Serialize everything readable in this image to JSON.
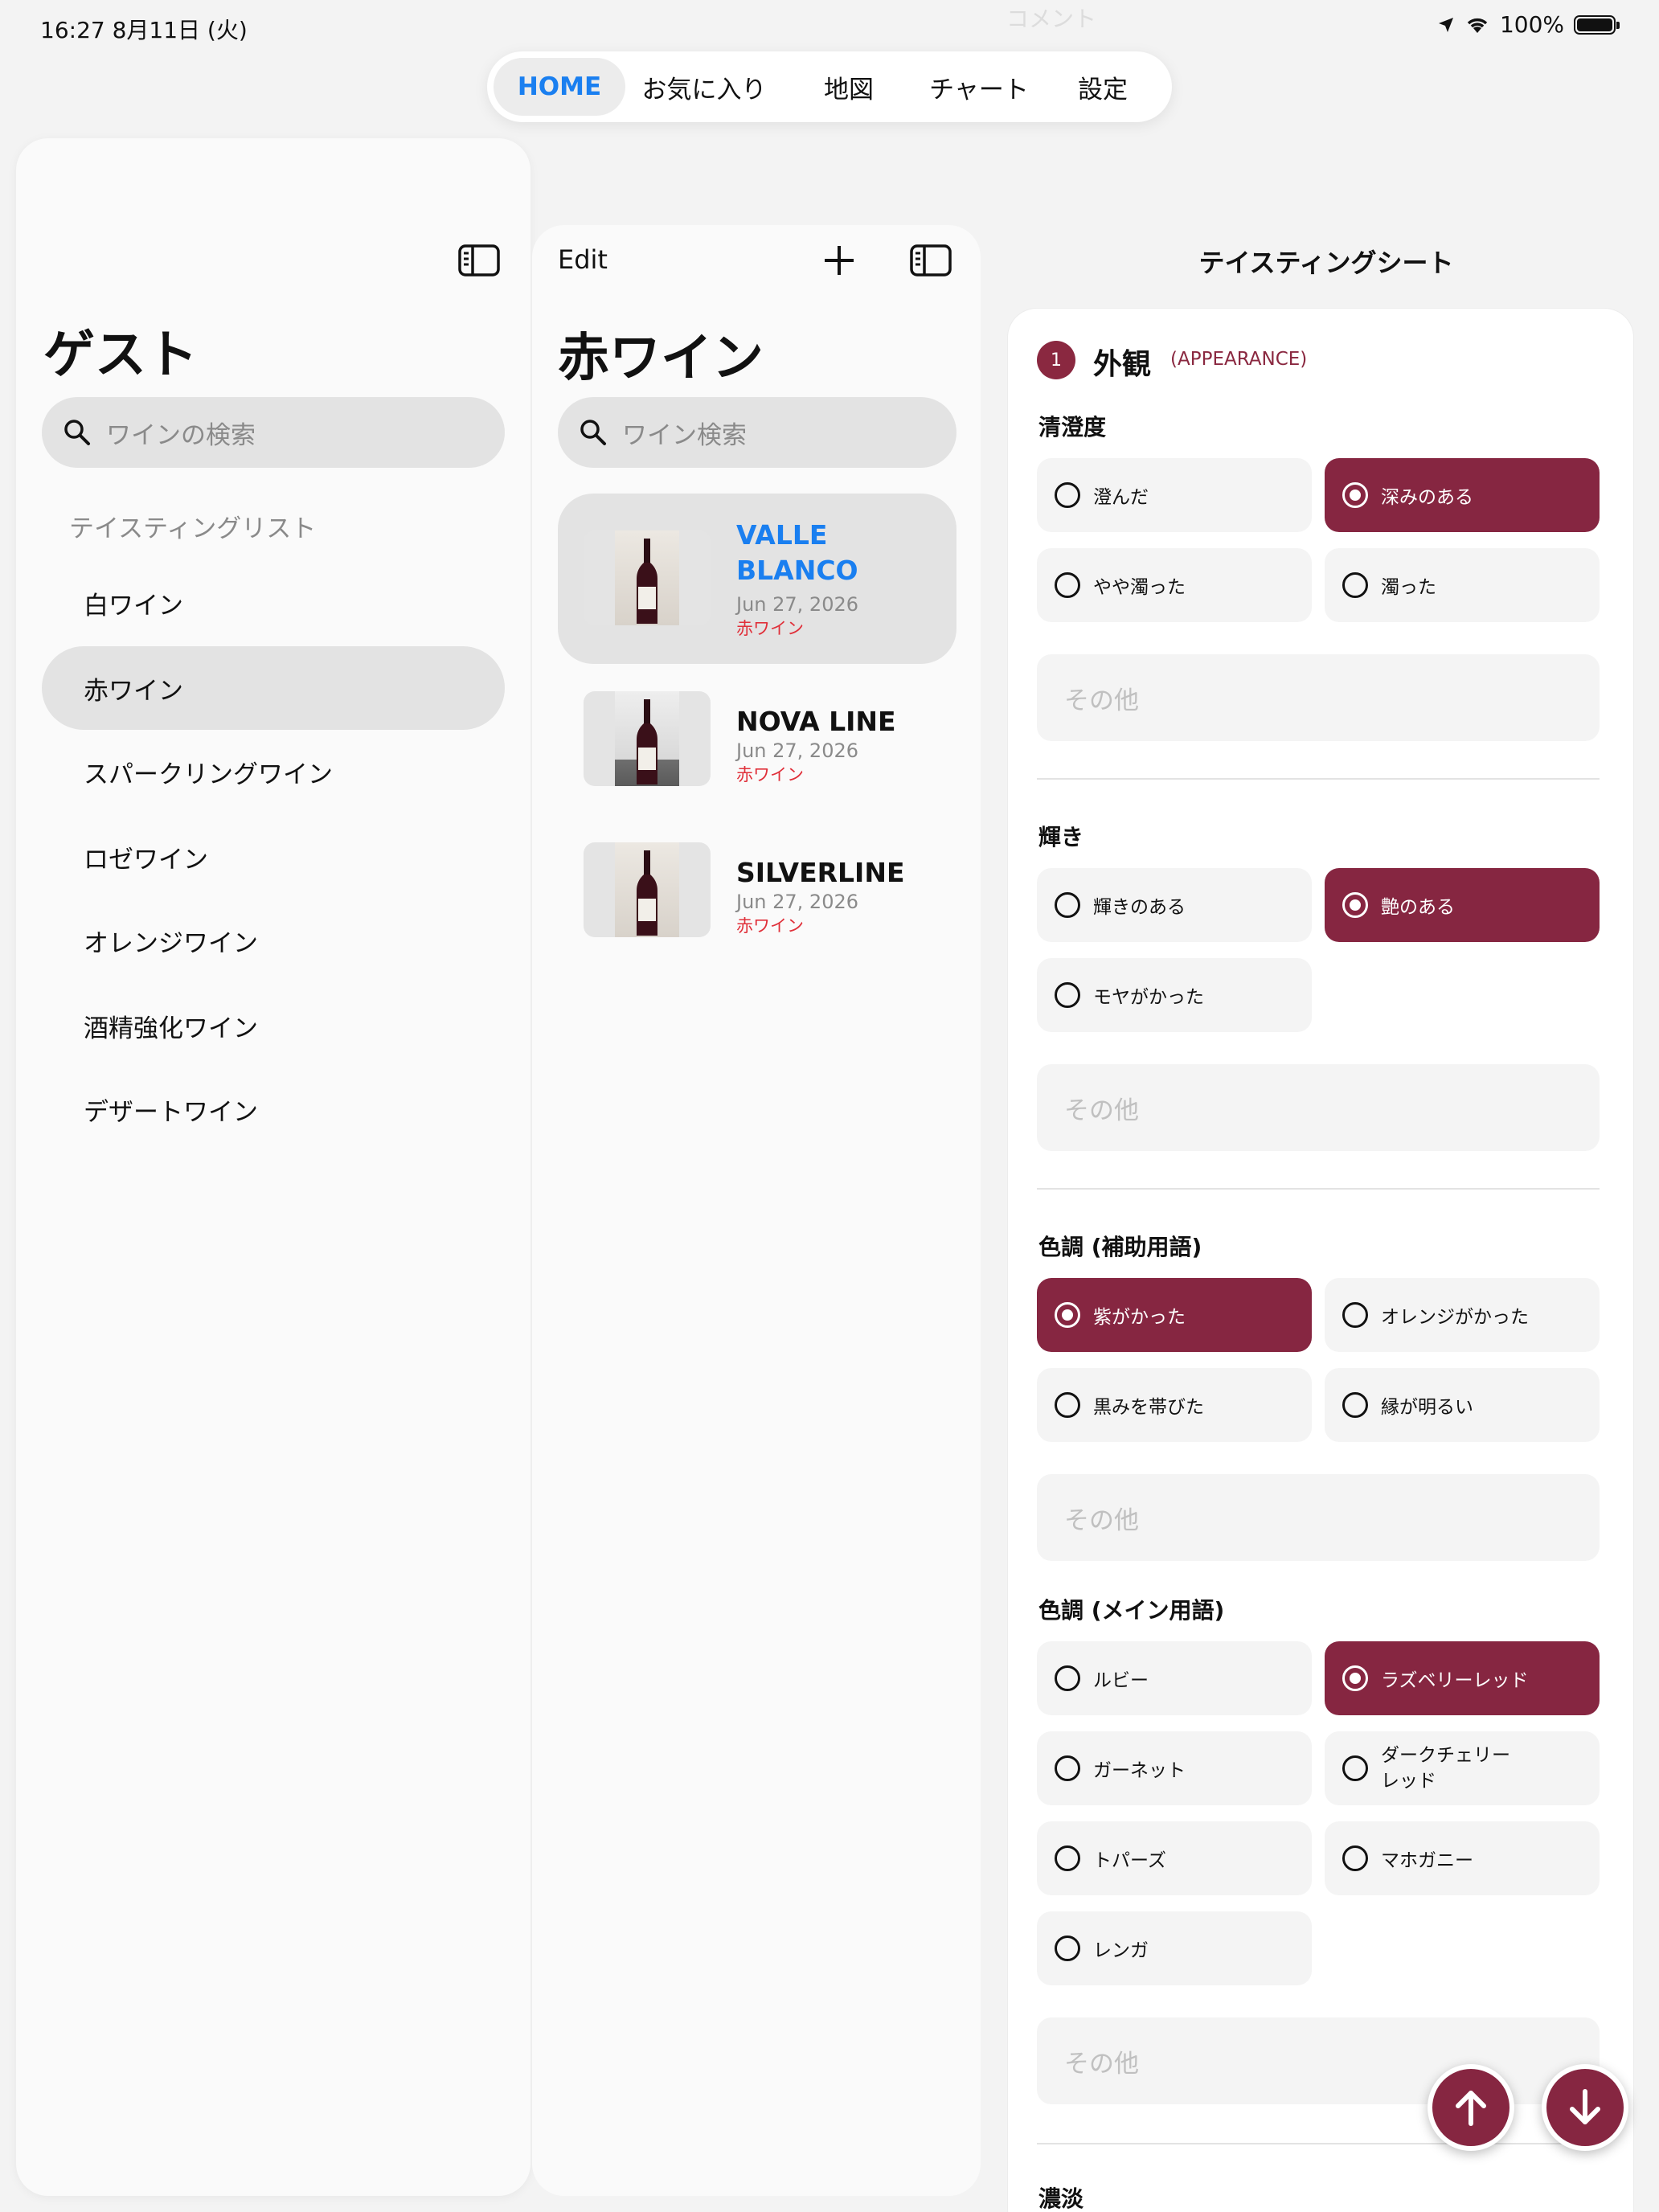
{
  "status": {
    "time": "16:27  8月11日 (火)",
    "battery": "100%"
  },
  "ghost_text": "コメント",
  "tabs": [
    {
      "label": "HOME",
      "active": true
    },
    {
      "label": "お気に入り"
    },
    {
      "label": "地図"
    },
    {
      "label": "チャート"
    },
    {
      "label": "設定"
    }
  ],
  "sidebar": {
    "title": "ゲスト",
    "search_placeholder": "ワインの検索",
    "section_label": "テイスティングリスト",
    "items": [
      {
        "label": "白ワイン"
      },
      {
        "label": "赤ワイン",
        "active": true
      },
      {
        "label": "スパークリングワイン"
      },
      {
        "label": "ロゼワイン"
      },
      {
        "label": "オレンジワイン"
      },
      {
        "label": "酒精強化ワイン"
      },
      {
        "label": "デザートワイン"
      }
    ]
  },
  "list": {
    "edit_label": "Edit",
    "title": "赤ワイン",
    "search_placeholder": "ワイン検索",
    "wines": [
      {
        "name": "VALLE BLANCO",
        "date": "Jun 27, 2026",
        "category": "赤ワイン",
        "active": true
      },
      {
        "name": "NOVA LINE",
        "date": "Jun 27, 2026",
        "category": "赤ワイン"
      },
      {
        "name": "SILVERLINE",
        "date": "Jun 27, 2026",
        "category": "赤ワイン"
      }
    ]
  },
  "detail": {
    "title": "テイスティングシート",
    "section_number": "1",
    "section_title": "外観",
    "section_subtitle": "(APPEARANCE)",
    "other_placeholder": "その他",
    "groups": [
      {
        "label": "清澄度",
        "options": [
          {
            "label": "澄んだ"
          },
          {
            "label": "深みのある",
            "selected": true
          },
          {
            "label": "やや濁った"
          },
          {
            "label": "濁った"
          }
        ]
      },
      {
        "label": "輝き",
        "options": [
          {
            "label": "輝きのある"
          },
          {
            "label": "艶のある",
            "selected": true
          },
          {
            "label": "モヤがかった"
          }
        ]
      },
      {
        "label": "色調 (補助用語)",
        "options": [
          {
            "label": "紫がかった",
            "selected": true
          },
          {
            "label": "オレンジがかった"
          },
          {
            "label": "黒みを帯びた"
          },
          {
            "label": "縁が明るい"
          }
        ]
      },
      {
        "label": "色調 (メイン用語)",
        "options": [
          {
            "label": "ルビー"
          },
          {
            "label": "ラズベリーレッド",
            "selected": true
          },
          {
            "label": "ガーネット"
          },
          {
            "label": "ダークチェリーレッド"
          },
          {
            "label": "トパーズ"
          },
          {
            "label": "マホガニー"
          },
          {
            "label": "レンガ"
          }
        ]
      },
      {
        "label": "濃淡"
      }
    ]
  },
  "colors": {
    "accent": "#1a7ff0",
    "wine": "#862641",
    "category_red": "#e0303a"
  },
  "icons": [
    "location-arrow-icon",
    "wifi-icon",
    "battery-icon",
    "sidebar-toggle-icon",
    "search-icon",
    "plus-icon",
    "bottle-icon",
    "arrow-up-icon",
    "arrow-down-icon"
  ]
}
